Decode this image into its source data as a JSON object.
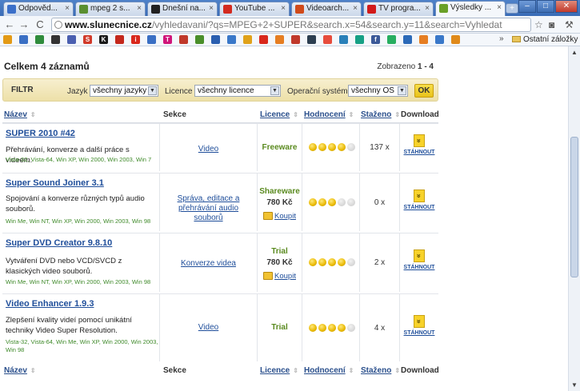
{
  "browser": {
    "tabs": [
      {
        "title": "Odpověd...",
        "fav": "#3b6fc9"
      },
      {
        "title": "mpeg 2 s...",
        "fav": "#5a8f30"
      },
      {
        "title": "Dnešní na...",
        "fav": "#222222"
      },
      {
        "title": "YouTube ...",
        "fav": "#d32a1f"
      },
      {
        "title": "Videoarch...",
        "fav": "#d04a1a"
      },
      {
        "title": "TV progra...",
        "fav": "#d21a1a"
      },
      {
        "title": "Výsledky ...",
        "fav": "#6aa028"
      }
    ],
    "url_domain": "www.slunecnice.cz",
    "url_path": "/vyhledavani/?qs=MPEG+2+SUPER&search.x=54&search.y=11&search=Vyhledat",
    "bookmarks_folder": "Ostatní záložky",
    "bookmarks_more": "»",
    "bookmark_icons": [
      {
        "name": "bookmark-icon-1",
        "color": "#e39a16",
        "glyph": ""
      },
      {
        "name": "bookmark-icon-2",
        "color": "#3a6fc4",
        "glyph": ""
      },
      {
        "name": "bookmark-icon-3",
        "color": "#2f8c3c",
        "glyph": ""
      },
      {
        "name": "bookmark-icon-4",
        "color": "#333333",
        "glyph": ""
      },
      {
        "name": "bookmark-icon-5",
        "color": "#4a5fb0",
        "glyph": ""
      },
      {
        "name": "bookmark-icon-6",
        "color": "#d13a2a",
        "glyph": "S"
      },
      {
        "name": "bookmark-icon-7",
        "color": "#1a1a1a",
        "glyph": "K"
      },
      {
        "name": "bookmark-icon-8",
        "color": "#c4281c",
        "glyph": ""
      },
      {
        "name": "bookmark-icon-9",
        "color": "#d9281c",
        "glyph": "i"
      },
      {
        "name": "bookmark-icon-10",
        "color": "#3a6fc4",
        "glyph": ""
      },
      {
        "name": "bookmark-icon-11",
        "color": "#d0157a",
        "glyph": "T"
      },
      {
        "name": "bookmark-icon-12",
        "color": "#c0392b",
        "glyph": ""
      },
      {
        "name": "bookmark-icon-13",
        "color": "#4a8f2a",
        "glyph": ""
      },
      {
        "name": "bookmark-icon-14",
        "color": "#2a5fb0",
        "glyph": ""
      },
      {
        "name": "bookmark-icon-15",
        "color": "#3a78c9",
        "glyph": ""
      },
      {
        "name": "bookmark-icon-16",
        "color": "#e0a21a",
        "glyph": ""
      },
      {
        "name": "bookmark-icon-17",
        "color": "#d9281c",
        "glyph": ""
      },
      {
        "name": "bookmark-icon-18",
        "color": "#e67e22",
        "glyph": ""
      },
      {
        "name": "bookmark-icon-19",
        "color": "#c0392b",
        "glyph": ""
      },
      {
        "name": "bookmark-icon-20",
        "color": "#2c3e50",
        "glyph": ""
      },
      {
        "name": "bookmark-icon-21",
        "color": "#e74c3c",
        "glyph": ""
      },
      {
        "name": "bookmark-icon-22",
        "color": "#2980b9",
        "glyph": ""
      },
      {
        "name": "bookmark-icon-23",
        "color": "#16a085",
        "glyph": ""
      },
      {
        "name": "bookmark-icon-24",
        "color": "#3b5998",
        "glyph": "f"
      },
      {
        "name": "bookmark-icon-25",
        "color": "#27ae60",
        "glyph": ""
      },
      {
        "name": "bookmark-icon-26",
        "color": "#2c6ab8",
        "glyph": ""
      },
      {
        "name": "bookmark-icon-27",
        "color": "#e67e22",
        "glyph": ""
      },
      {
        "name": "bookmark-icon-28",
        "color": "#3a78c9",
        "glyph": ""
      },
      {
        "name": "bookmark-icon-29",
        "color": "#e08a1a",
        "glyph": ""
      }
    ]
  },
  "results": {
    "count_label": "Celkem 4 záznamů",
    "shown_label": "Zobrazeno",
    "shown_range": "1 - 4"
  },
  "filter": {
    "title": "FILTR",
    "language_label": "Jazyk",
    "language_value": "všechny jazyky",
    "license_label": "Licence",
    "license_value": "všechny licence",
    "os_label": "Operační systém",
    "os_value": "všechny OS",
    "ok_label": "OK"
  },
  "columns": {
    "name": "Název",
    "section": "Sekce",
    "license": "Licence",
    "rating": "Hodnocení",
    "downloaded": "Staženo",
    "download": "Download"
  },
  "download_label": "STÁHNOUT",
  "buy_label": "Koupit",
  "rows": [
    {
      "name": "SUPER 2010 #42",
      "desc": "Přehrávání, konverze a další práce s videem.",
      "os": "Vista-32, Vista-64, Win XP, Win 2000, Win 2003, Win 7",
      "section": "Video",
      "license": "Freeware",
      "price": "",
      "rating": 4,
      "downloads": "137 x"
    },
    {
      "name": "Super Sound Joiner 3.1",
      "desc": "Spojování a konverze různých typů audio souborů.",
      "os": "Win Me, Win NT, Win XP, Win 2000, Win 2003, Win 98",
      "section": "Správa, editace a přehrávání audio souborů",
      "license": "Shareware",
      "price": "780 Kč",
      "rating": 3,
      "downloads": "0 x"
    },
    {
      "name": "Super DVD Creator 9.8.10",
      "desc": "Vytváření DVD nebo VCD/SVCD z klasických video souborů.",
      "os": "Win Me, Win NT, Win XP, Win 2000, Win 2003, Win 98",
      "section": "Konverze videa",
      "license": "Trial",
      "price": "780 Kč",
      "rating": 4,
      "downloads": "2 x"
    },
    {
      "name": "Video Enhancer 1.9.3",
      "desc": "Zlepšení kvality videí pomocí unikátní techniky Video Super Resolution.",
      "os": "Vista-32, Vista-64, Win Me, Win XP, Win 2000, Win 2003, Win 98",
      "section": "Video",
      "license": "Trial",
      "price": "",
      "rating": 4,
      "downloads": "4 x"
    }
  ]
}
